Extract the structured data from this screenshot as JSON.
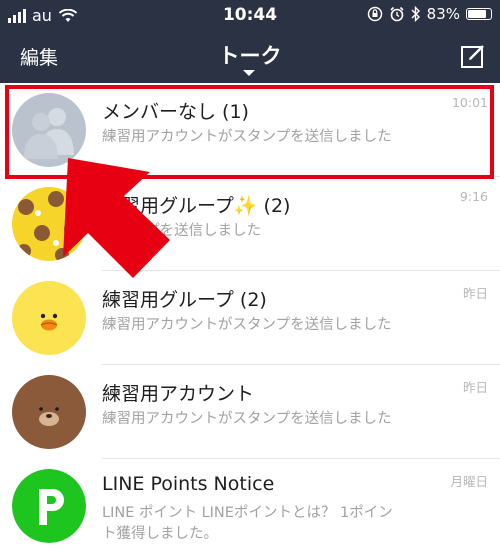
{
  "status_bar": {
    "carrier": "au",
    "time": "10:44",
    "battery": "83%",
    "battery_level": 0.83
  },
  "nav": {
    "edit_label": "編集",
    "title": "トーク",
    "compose_icon": "compose-icon"
  },
  "chats": [
    {
      "name": "メンバーなし (1)",
      "preview": "練習用アカウントがスタンプを送信しました",
      "time": "10:01",
      "avatar": "default-group-avatar"
    },
    {
      "name": "練習用グループ✨ (2)",
      "preview": "スタンプを送信しました",
      "time": "9:16",
      "avatar": "brown-cony-pattern-avatar"
    },
    {
      "name": "練習用グループ (2)",
      "preview": "練習用アカウントがスタンプを送信しました",
      "time": "昨日",
      "avatar": "sally-avatar"
    },
    {
      "name": "練習用アカウント",
      "preview": "練習用アカウントがスタンプを送信しました",
      "time": "昨日",
      "avatar": "brown-avatar"
    },
    {
      "name": "LINE Points Notice",
      "preview": "LINE ポイント LINEポイントとは？ 1ポイント獲得しました。",
      "time": "月曜日",
      "avatar": "line-points-avatar"
    }
  ],
  "colors": {
    "header_bg": "#2b3243",
    "highlight": "#e60012",
    "arrow": "#e60012",
    "line_points_green": "#1ec51e"
  }
}
